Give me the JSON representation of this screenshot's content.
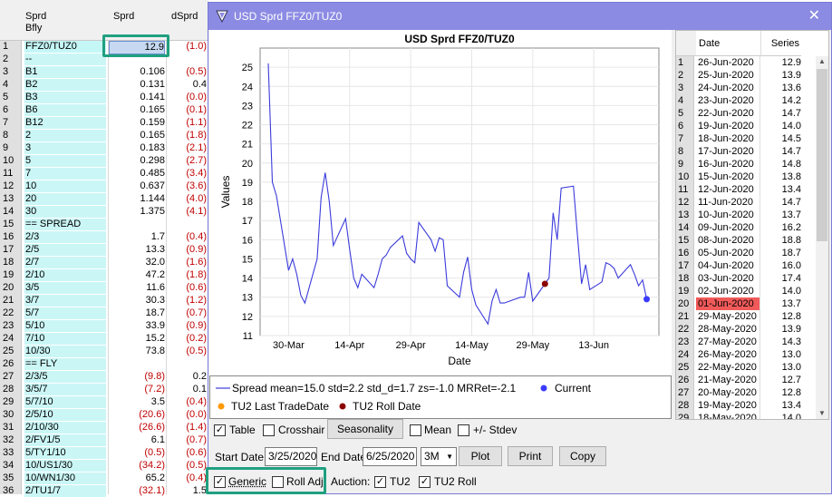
{
  "sheet": {
    "headers": {
      "col_a_line1": "Sprd",
      "col_a_line2": "Bfly",
      "col_b": "Sprd",
      "col_c": "dSprd"
    },
    "rows": [
      {
        "n": "1",
        "label": "FFZ0/TUZ0",
        "v": "12.9",
        "d": "(1.0)",
        "hl": true
      },
      {
        "n": "2",
        "label": "--",
        "v": "",
        "d": ""
      },
      {
        "n": "3",
        "label": "B1",
        "v": "0.106",
        "d": "(0.5)"
      },
      {
        "n": "4",
        "label": "B2",
        "v": "0.131",
        "d": "0.4",
        "pos": true
      },
      {
        "n": "5",
        "label": "B3",
        "v": "0.141",
        "d": "(0.0)"
      },
      {
        "n": "6",
        "label": "B6",
        "v": "0.165",
        "d": "(0.1)"
      },
      {
        "n": "7",
        "label": "B12",
        "v": "0.159",
        "d": "(1.1)"
      },
      {
        "n": "8",
        "label": "2",
        "v": "0.165",
        "d": "(1.8)"
      },
      {
        "n": "9",
        "label": "3",
        "v": "0.183",
        "d": "(2.1)"
      },
      {
        "n": "10",
        "label": "5",
        "v": "0.298",
        "d": "(2.7)"
      },
      {
        "n": "11",
        "label": "7",
        "v": "0.485",
        "d": "(3.4)"
      },
      {
        "n": "12",
        "label": "10",
        "v": "0.637",
        "d": "(3.6)"
      },
      {
        "n": "13",
        "label": "20",
        "v": "1.144",
        "d": "(4.0)"
      },
      {
        "n": "14",
        "label": "30",
        "v": "1.375",
        "d": "(4.1)"
      },
      {
        "n": "15",
        "label": "== SPREAD",
        "v": "",
        "d": ""
      },
      {
        "n": "16",
        "label": "2/3",
        "v": "1.7",
        "d": "(0.4)"
      },
      {
        "n": "17",
        "label": "2/5",
        "v": "13.3",
        "d": "(0.9)"
      },
      {
        "n": "18",
        "label": "2/7",
        "v": "32.0",
        "d": "(1.6)"
      },
      {
        "n": "19",
        "label": "2/10",
        "v": "47.2",
        "d": "(1.8)"
      },
      {
        "n": "20",
        "label": "3/5",
        "v": "11.6",
        "d": "(0.6)"
      },
      {
        "n": "21",
        "label": "3/7",
        "v": "30.3",
        "d": "(1.2)"
      },
      {
        "n": "22",
        "label": "5/7",
        "v": "18.7",
        "d": "(0.7)"
      },
      {
        "n": "23",
        "label": "5/10",
        "v": "33.9",
        "d": "(0.9)"
      },
      {
        "n": "24",
        "label": "7/10",
        "v": "15.2",
        "d": "(0.2)"
      },
      {
        "n": "25",
        "label": "10/30",
        "v": "73.8",
        "d": "(0.5)"
      },
      {
        "n": "26",
        "label": "== FLY",
        "v": "",
        "d": ""
      },
      {
        "n": "27",
        "label": "2/3/5",
        "v": "(9.8)",
        "d": "0.2",
        "pos": true,
        "vred": true
      },
      {
        "n": "28",
        "label": "3/5/7",
        "v": "(7.2)",
        "d": "0.1",
        "pos": true,
        "vred": true
      },
      {
        "n": "29",
        "label": "5/7/10",
        "v": "3.5",
        "d": "(0.4)"
      },
      {
        "n": "30",
        "label": "2/5/10",
        "v": "(20.6)",
        "d": "(0.0)",
        "vred": true
      },
      {
        "n": "31",
        "label": "2/10/30",
        "v": "(26.6)",
        "d": "(1.4)",
        "vred": true
      },
      {
        "n": "32",
        "label": "2/FV1/5",
        "v": "6.1",
        "d": "(0.7)"
      },
      {
        "n": "33",
        "label": "5/TY1/10",
        "v": "(0.5)",
        "d": "(0.6)",
        "vred": true
      },
      {
        "n": "34",
        "label": "10/US1/30",
        "v": "(34.2)",
        "d": "(0.5)",
        "vred": true
      },
      {
        "n": "35",
        "label": "10/WN1/30",
        "v": "65.2",
        "d": "(0.4)"
      },
      {
        "n": "36",
        "label": "2/TU1/7",
        "v": "(32.1)",
        "d": "1.5",
        "pos": true,
        "vred": true
      }
    ]
  },
  "dialog": {
    "title": "USD Sprd FFZ0/TUZ0",
    "close": "✕",
    "table_headers": {
      "date": "Date",
      "series": "Series"
    },
    "table_rows": [
      {
        "i": "1",
        "date": "26-Jun-2020",
        "s": "12.9"
      },
      {
        "i": "2",
        "date": "25-Jun-2020",
        "s": "13.9"
      },
      {
        "i": "3",
        "date": "24-Jun-2020",
        "s": "13.6"
      },
      {
        "i": "4",
        "date": "23-Jun-2020",
        "s": "14.2"
      },
      {
        "i": "5",
        "date": "22-Jun-2020",
        "s": "14.7"
      },
      {
        "i": "6",
        "date": "19-Jun-2020",
        "s": "14.0"
      },
      {
        "i": "7",
        "date": "18-Jun-2020",
        "s": "14.5"
      },
      {
        "i": "8",
        "date": "17-Jun-2020",
        "s": "14.7"
      },
      {
        "i": "9",
        "date": "16-Jun-2020",
        "s": "14.8"
      },
      {
        "i": "10",
        "date": "15-Jun-2020",
        "s": "13.8"
      },
      {
        "i": "11",
        "date": "12-Jun-2020",
        "s": "13.4"
      },
      {
        "i": "12",
        "date": "11-Jun-2020",
        "s": "14.7"
      },
      {
        "i": "13",
        "date": "10-Jun-2020",
        "s": "13.7"
      },
      {
        "i": "14",
        "date": "09-Jun-2020",
        "s": "16.2"
      },
      {
        "i": "15",
        "date": "08-Jun-2020",
        "s": "18.8"
      },
      {
        "i": "16",
        "date": "05-Jun-2020",
        "s": "18.7"
      },
      {
        "i": "17",
        "date": "04-Jun-2020",
        "s": "16.0"
      },
      {
        "i": "18",
        "date": "03-Jun-2020",
        "s": "17.4"
      },
      {
        "i": "19",
        "date": "02-Jun-2020",
        "s": "14.0"
      },
      {
        "i": "20",
        "date": "01-Jun-2020",
        "s": "13.7",
        "red": true
      },
      {
        "i": "21",
        "date": "29-May-2020",
        "s": "12.8"
      },
      {
        "i": "22",
        "date": "28-May-2020",
        "s": "13.9"
      },
      {
        "i": "23",
        "date": "27-May-2020",
        "s": "14.3"
      },
      {
        "i": "24",
        "date": "26-May-2020",
        "s": "13.0"
      },
      {
        "i": "25",
        "date": "22-May-2020",
        "s": "13.0"
      },
      {
        "i": "26",
        "date": "21-May-2020",
        "s": "12.7"
      },
      {
        "i": "27",
        "date": "20-May-2020",
        "s": "12.8"
      },
      {
        "i": "28",
        "date": "19-May-2020",
        "s": "13.4"
      },
      {
        "i": "29",
        "date": "18-May-2020",
        "s": "14.0"
      }
    ],
    "legend": {
      "spread": "Spread  mean=15.0  std=2.2  std_d=1.7  zs=-1.0  MRRet=-2.1",
      "current": "Current",
      "last_trade": "TU2 Last TradeDate",
      "roll": "TU2 Roll Date"
    },
    "controls": {
      "table": "Table",
      "crosshair": "Crosshair",
      "seasonality": "Seasonality",
      "mean": "Mean",
      "stdev": "+/- Stdev",
      "start_label": "Start Date",
      "start_value": "3/25/2020",
      "end_label": "End Date",
      "end_value": "6/25/2020",
      "period": "3M",
      "plot": "Plot",
      "print": "Print",
      "copy": "Copy",
      "generic": "Generic",
      "roll_adj": "Roll Adj",
      "auction": "Auction:",
      "tu2": "TU2",
      "tu2_roll": "TU2 Roll"
    },
    "colors": {
      "line": "#3b3bdc",
      "current": "#3b3bff",
      "roll": "#8b0000",
      "last_trade": "#ff9900",
      "accent": "#20a080"
    }
  },
  "chart_data": {
    "type": "line",
    "title": "USD Sprd FFZ0/TUZ0",
    "xlabel": "Date",
    "ylabel": "Values",
    "ylim": [
      11,
      26
    ],
    "yticks": [
      11,
      12,
      13,
      14,
      15,
      16,
      17,
      18,
      19,
      20,
      21,
      22,
      23,
      24,
      25
    ],
    "xticks": [
      "30-Mar",
      "14-Apr",
      "29-Apr",
      "14-May",
      "29-May",
      "13-Jun"
    ],
    "grid": true,
    "series": [
      {
        "name": "Spread",
        "x": [
          "2020-03-25",
          "2020-03-26",
          "2020-03-27",
          "2020-03-30",
          "2020-03-31",
          "2020-04-01",
          "2020-04-02",
          "2020-04-03",
          "2020-04-06",
          "2020-04-07",
          "2020-04-08",
          "2020-04-09",
          "2020-04-10",
          "2020-04-13",
          "2020-04-14",
          "2020-04-15",
          "2020-04-16",
          "2020-04-17",
          "2020-04-20",
          "2020-04-21",
          "2020-04-22",
          "2020-04-23",
          "2020-04-24",
          "2020-04-27",
          "2020-04-28",
          "2020-04-29",
          "2020-04-30",
          "2020-05-01",
          "2020-05-04",
          "2020-05-05",
          "2020-05-06",
          "2020-05-07",
          "2020-05-08",
          "2020-05-11",
          "2020-05-12",
          "2020-05-13",
          "2020-05-14",
          "2020-05-15",
          "2020-05-18",
          "2020-05-19",
          "2020-05-20",
          "2020-05-21",
          "2020-05-22",
          "2020-05-26",
          "2020-05-27",
          "2020-05-28",
          "2020-05-29",
          "2020-06-01",
          "2020-06-02",
          "2020-06-03",
          "2020-06-04",
          "2020-06-05",
          "2020-06-08",
          "2020-06-09",
          "2020-06-10",
          "2020-06-11",
          "2020-06-12",
          "2020-06-15",
          "2020-06-16",
          "2020-06-17",
          "2020-06-18",
          "2020-06-19",
          "2020-06-22",
          "2020-06-23",
          "2020-06-24",
          "2020-06-25",
          "2020-06-26"
        ],
        "values": [
          25.2,
          19.0,
          18.3,
          14.4,
          15.0,
          14.2,
          13.1,
          12.7,
          15.0,
          18.2,
          19.5,
          18.0,
          15.7,
          17.1,
          15.5,
          14.0,
          13.5,
          14.2,
          13.5,
          14.2,
          15.0,
          15.2,
          15.6,
          16.2,
          15.3,
          15.0,
          14.8,
          16.9,
          16.0,
          15.4,
          16.1,
          16.0,
          13.6,
          13.0,
          14.3,
          15.1,
          13.4,
          12.6,
          11.6,
          12.8,
          13.4,
          12.7,
          12.7,
          13.0,
          13.0,
          14.3,
          12.8,
          13.7,
          14.0,
          17.4,
          16.0,
          18.7,
          18.8,
          16.2,
          13.7,
          14.7,
          13.4,
          13.8,
          14.8,
          14.7,
          14.5,
          14.0,
          14.7,
          14.2,
          13.6,
          13.9,
          12.9
        ]
      }
    ],
    "markers": [
      {
        "name": "Current",
        "x": "2020-06-26",
        "y": 12.9
      },
      {
        "name": "TU2 Roll Date",
        "x": "2020-06-01",
        "y": 13.7
      }
    ]
  }
}
